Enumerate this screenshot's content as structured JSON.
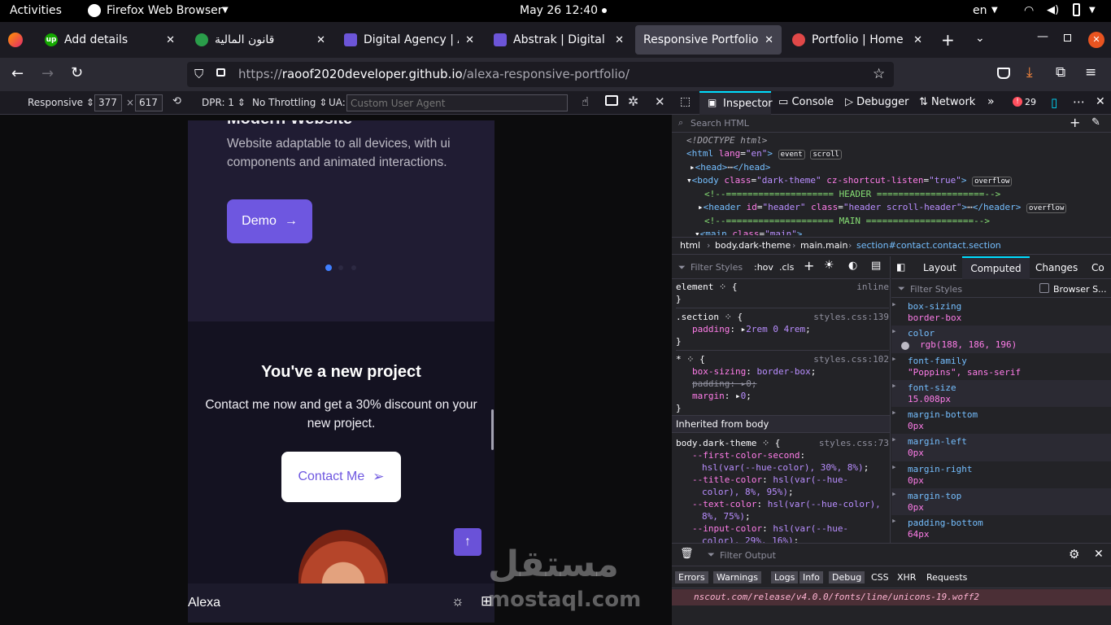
{
  "topbar": {
    "activities": "Activities",
    "app": "Firefox Web Browser",
    "datetime": "May 26  12:40",
    "lang": "en"
  },
  "tabs": [
    {
      "title": "Add details",
      "fav_color": "#14a800",
      "fav_text": "up"
    },
    {
      "title": "قانون المالية",
      "fav_color": "#2a9d4a",
      "fav_text": ""
    },
    {
      "title": "Digital Agency | Ab",
      "fav_color": "#6c55d8",
      "fav_text": ""
    },
    {
      "title": "Abstrak | Digital Ag",
      "fav_color": "#6c55d8",
      "fav_text": ""
    },
    {
      "title": "Responsive Portfolio W",
      "fav_color": "",
      "fav_text": ""
    },
    {
      "title": "Portfolio | Home",
      "fav_color": "#e04848",
      "fav_text": ""
    }
  ],
  "url": {
    "prefix": "https://",
    "host": "raoof2020developer.github.io",
    "path": "/alexa-responsive-portfolio/"
  },
  "rdm": {
    "device": "Responsive",
    "width": "377",
    "height": "617",
    "dpr": "DPR: 1",
    "throttle": "No Throttling",
    "ua_label": "UA:",
    "ua_placeholder": "Custom User Agent"
  },
  "phone": {
    "heading_partial": "Modern Website",
    "desc": "Website adaptable to all devices, with ui components and animated interactions.",
    "demo": "Demo",
    "project_title": "You've a new project",
    "project_text": "Contact me now and get a 30% discount on your new project.",
    "contact": "Contact Me",
    "logo": "Alexa"
  },
  "devtools": {
    "tabs": [
      "Inspector",
      "Console",
      "Debugger",
      "Network"
    ],
    "error_count": "29",
    "search_placeholder": "Search HTML",
    "breadcrumb": [
      "html",
      "body.dark-theme",
      "main.main",
      "section#contact.contact.section"
    ],
    "rules_filter": "Filter Styles",
    "hov": ":hov",
    "cls": ".cls",
    "side_tabs": [
      "Layout",
      "Computed",
      "Changes",
      "Co"
    ],
    "computed_filter": "Filter Styles",
    "browser_styles": "Browser S...",
    "computed": [
      {
        "prop": "box-sizing",
        "val": "border-box"
      },
      {
        "prop": "color",
        "val": "rgb(188, 186, 196)"
      },
      {
        "prop": "font-family",
        "val": "\"Poppins\", sans-serif"
      },
      {
        "prop": "font-size",
        "val": "15.008px"
      },
      {
        "prop": "margin-bottom",
        "val": "0px"
      },
      {
        "prop": "margin-left",
        "val": "0px"
      },
      {
        "prop": "margin-right",
        "val": "0px"
      },
      {
        "prop": "margin-top",
        "val": "0px"
      },
      {
        "prop": "padding-bottom",
        "val": "64px"
      }
    ],
    "console_filter": "Filter Output",
    "console_buttons": [
      "Errors",
      "Warnings",
      "Logs",
      "Info",
      "Debug"
    ],
    "console_extra": [
      "CSS",
      "XHR",
      "Requests"
    ],
    "console_msg": "nscout.com/release/v4.0.0/fonts/line/unicons-19.woff2",
    "inherited": "Inherited from body"
  },
  "watermark": {
    "ar": "مستقل",
    "latin": "mostaql.com"
  }
}
